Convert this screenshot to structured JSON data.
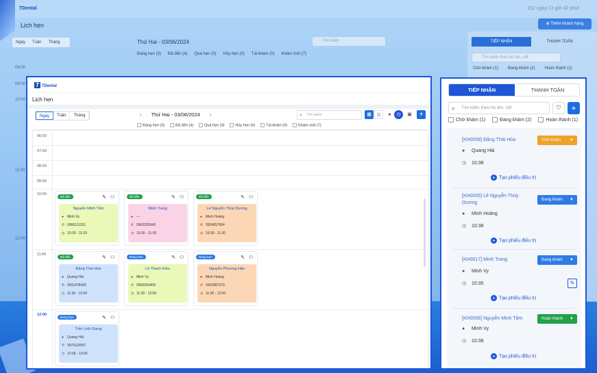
{
  "background": {
    "logo": "TDental",
    "time": "152 ngày 22 giờ 42 phút",
    "title": "Lịch hẹn",
    "add_customer": "Thêm khách hàng",
    "view_tabs": [
      "Ngày",
      "Tuần",
      "Tháng"
    ],
    "date": "Thứ Hai - 03/06/2024",
    "search_placeholder": "Tìm kiếm",
    "legend": [
      "Đang hẹn (3)",
      "Đã đến (4)",
      "Quá hẹn (0)",
      "Hủy hẹn (0)",
      "Tái khám (0)",
      "Khám mới (7)"
    ],
    "times": [
      "08:00",
      "09:00",
      "10:00",
      "11:00",
      "12:00"
    ],
    "right_tabs": [
      "TIẾP NHẬN",
      "THANH TOÁN"
    ],
    "right_search": "Tìm kiếm theo họ tên, sđt",
    "right_legend": [
      "Chờ khám (1)",
      "Đang khám (2)",
      "Hoàn thành (1)"
    ]
  },
  "main": {
    "logo": "TDental",
    "title": "Lịch hẹn",
    "view_tabs": [
      "Ngày",
      "Tuần",
      "Tháng"
    ],
    "date": "Thứ Hai - 03/06/2024",
    "prev": "‹",
    "next": "›",
    "search_placeholder": "Tìm kiếm",
    "legend": [
      "Đang hẹn (3)",
      "Đã đến (4)",
      "Quá hẹn (0)",
      "Hủy hẹn (0)",
      "Tái khám (0)",
      "Khám mới (7)"
    ],
    "times": [
      "06:00",
      "07:00",
      "08:00",
      "09:00",
      "10:00",
      "11:00",
      "12:00"
    ],
    "appointments": [
      {
        "status": "Đã đến",
        "name": "Nguyễn Minh Tâm",
        "doctor": "Minh Vy",
        "phone": "0966111331",
        "time": "10:30 - 11:20"
      },
      {
        "status": "Đã đến",
        "name": "Minh Trang",
        "doctor": "---",
        "phone": "0903255949",
        "time": "10:30 - 11:30"
      },
      {
        "status": "Đã đến",
        "name": "Lê Nguyễn Thùy Dương",
        "doctor": "Minh Hoàng",
        "phone": "0924657904",
        "time": "10:30 - 11:30"
      },
      {
        "status": "Đã đến",
        "name": "Đặng Thái Hòa",
        "doctor": "Quang Hải",
        "phone": "0931478425",
        "time": "11:30 - 12:00"
      },
      {
        "status": "Đang hẹn",
        "name": "Lê Thanh Kiều",
        "doctor": "Minh Vy",
        "phone": "0965053409",
        "time": "11:30 - 12:00"
      },
      {
        "status": "Đang hẹn",
        "name": "Nguyễn Phương Hảo",
        "doctor": "Minh Hoàng",
        "phone": "0332987379",
        "time": "11:30 - 12:00"
      },
      {
        "status": "Đang hẹn",
        "name": "Trần Linh Giang",
        "doctor": "Quang Hải",
        "phone": "0975116557",
        "time": "12:00 - 13:00"
      }
    ]
  },
  "panel": {
    "tabs": [
      "TIẾP NHẬN",
      "THANH TOÁN"
    ],
    "search_placeholder": "Tìm kiếm theo họ tên, sđt",
    "legend": [
      "Chờ khám (1)",
      "Đang khám (2)",
      "Hoàn thành (1)"
    ],
    "action": "Tạo phiếu điều trị",
    "patients": [
      {
        "code": "[KH0008] Đặng Thái Hòa",
        "status": "Chờ khám",
        "doctor": "Quang Hải",
        "time": "10:38"
      },
      {
        "code": "[KH0005] Lê Nguyễn Thùy Dương",
        "status": "Đang khám",
        "doctor": "Minh Hoàng",
        "time": "10:38"
      },
      {
        "code": "[KH0017] Minh Trang",
        "status": "Đang khám",
        "doctor": "Minh Vy",
        "time": "10:35"
      },
      {
        "code": "[KH0006] Nguyễn Minh Tâm",
        "status": "Hoàn thành",
        "doctor": "Minh Vy",
        "time": "10:38"
      }
    ]
  },
  "colors": {
    "accent": "#1e56d8",
    "arrived": "#22a04a",
    "booked": "#2f7be6",
    "waiting": "#f0a12a",
    "in_exam": "#2f7be6",
    "done": "#22a04a"
  }
}
